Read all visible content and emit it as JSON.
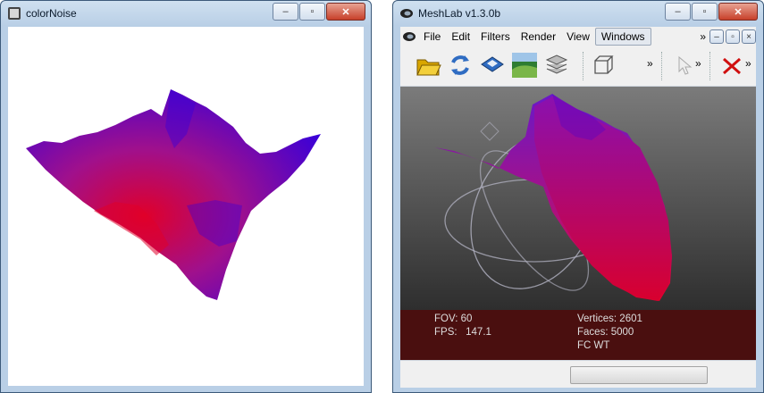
{
  "left_window": {
    "title": "colorNoise"
  },
  "right_window": {
    "title": "MeshLab v1.3.0b",
    "menus": [
      "File",
      "Edit",
      "Filters",
      "Render",
      "View",
      "Windows"
    ],
    "overflow_glyph": "»",
    "mdi_buttons": [
      "–",
      "▫",
      "×"
    ],
    "info": {
      "fov": "FOV: 60",
      "fps": "FPS:   147.1",
      "vertices": "Vertices: 2601",
      "faces": "Faces: 5000",
      "mode": "FC WT"
    }
  },
  "window_controls": {
    "minimize": "–",
    "maximize": "▫",
    "close": "✕"
  },
  "colors": {
    "mesh_red": "#e0002a",
    "mesh_blue": "#3a00d8",
    "info_bg": "#4a0f0f"
  }
}
